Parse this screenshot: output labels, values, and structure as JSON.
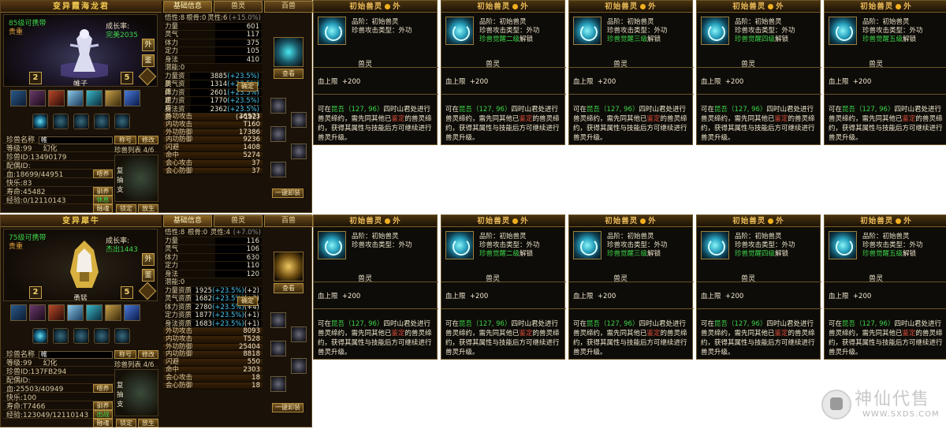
{
  "pet_panels": [
    {
      "title": "变异霞海龙君",
      "tabs": [
        "基础信息",
        "兽灵",
        "百兽"
      ],
      "carry": "85级可携带",
      "quality": "贵重",
      "growth_label": "成长率:",
      "growth_value": "完美2035",
      "grade_left": "2",
      "grade_right": "5",
      "side_buttons": [
        "外",
        "鉴"
      ],
      "pet_label": "帷子",
      "name_label": "珍兽名称",
      "name_value": "帷",
      "nick_btn": "称号",
      "modify_btn": "修改",
      "level": "等级:99",
      "phantom": "幻化",
      "pet_id": "珍兽ID:13490179",
      "spouse": "配偶ID:",
      "list_label": "珍兽列表 4/6",
      "hp": "血:18699/44951",
      "happy": "快乐:83",
      "life": "寿命:45482",
      "exp": "经验:0/12110143",
      "btn_feed": "喂养",
      "btn_tame": "驯养",
      "btn_status": "休息",
      "btn_fuse": "融魂",
      "btn_lock": "锁定",
      "btn_release": "放生",
      "list_side": "复\n抽\n支",
      "bone": "悟性:8",
      "root": "根骨:0",
      "spirit": "灵性:6",
      "spirit_extra": "(+15.0%)",
      "stats": [
        {
          "label": "力量",
          "value": "601"
        },
        {
          "label": "灵气",
          "value": "117"
        },
        {
          "label": "体力",
          "value": "375"
        },
        {
          "label": "定力",
          "value": "105"
        },
        {
          "label": "身法",
          "value": "410"
        }
      ],
      "potential": "潜能:0",
      "confirm": "确定",
      "aptitudes": [
        {
          "label": "力量资质",
          "base": "3885",
          "pct": "(+23.5%)",
          "bonus": "(+584)"
        },
        {
          "label": "灵气资质",
          "base": "1314",
          "pct": "(+23.5%)",
          "bonus": "(+138)"
        },
        {
          "label": "体力资质",
          "base": "2601",
          "pct": "(+23.5%)",
          "bonus": "(+211)"
        },
        {
          "label": "定力资质",
          "base": "1770",
          "pct": "(+23.5%)",
          "bonus": "(+98)"
        },
        {
          "label": "身法资质",
          "base": "2362",
          "pct": "(+23.5%)",
          "bonus": "(+192)"
        }
      ],
      "attrs": [
        {
          "label": "外功攻击",
          "value": "36573"
        },
        {
          "label": "内功攻击",
          "value": "T160"
        },
        {
          "label": "外功防御",
          "value": "17386"
        },
        {
          "label": "内功防御",
          "value": "9236"
        },
        {
          "label": "闪避",
          "value": "1408"
        },
        {
          "label": "命中",
          "value": "5274"
        },
        {
          "label": "会心攻击",
          "value": "37"
        },
        {
          "label": "会心防御",
          "value": "37"
        }
      ],
      "view_btn": "查看",
      "unload_btn": "一键卸装"
    },
    {
      "title": "变异犀牛",
      "tabs": [
        "基础信息",
        "兽灵",
        "百兽"
      ],
      "carry": "75级可携带",
      "quality": "贵重",
      "growth_label": "成长率:",
      "growth_value": "杰出1443",
      "grade_left": "2",
      "grade_right": "5",
      "side_buttons": [
        "外",
        "鉴"
      ],
      "pet_label": "勇猛",
      "name_label": "珍兽名称",
      "name_value": "帷",
      "nick_btn": "称号",
      "modify_btn": "修改",
      "level": "等级:99",
      "phantom": "幻化",
      "pet_id": "珍兽ID:137FB294",
      "spouse": "配偶ID:",
      "list_label": "珍兽列表 4/6",
      "hp": "血:25503/40949",
      "happy": "快乐:100",
      "life": "寿命:T7466",
      "exp": "经验:123049/12110143",
      "btn_feed": "喂养",
      "btn_tame": "驯养",
      "btn_status": "出战",
      "btn_fuse": "融魂",
      "btn_lock": "锁定",
      "btn_release": "放生",
      "list_side": "复\n抽\n支",
      "bone": "悟性:8",
      "root": "根骨:0",
      "spirit": "灵性:4",
      "spirit_extra": "(+7.0%)",
      "stats": [
        {
          "label": "力量",
          "value": "116"
        },
        {
          "label": "灵气",
          "value": "106"
        },
        {
          "label": "体力",
          "value": "630"
        },
        {
          "label": "定力",
          "value": "110"
        },
        {
          "label": "身法",
          "value": "120"
        }
      ],
      "potential": "潜能:0",
      "confirm": "确定",
      "aptitudes": [
        {
          "label": "力量资质",
          "base": "1925",
          "pct": "(+23.5%)",
          "bonus": "(+2)"
        },
        {
          "label": "灵气资质",
          "base": "1682",
          "pct": "(+23.5%)",
          "bonus": "(+3)"
        },
        {
          "label": "体力资质",
          "base": "2780",
          "pct": "(+23.5%)",
          "bonus": "(+4)"
        },
        {
          "label": "定力资质",
          "base": "1877",
          "pct": "(+23.5%)",
          "bonus": "(+1)"
        },
        {
          "label": "身法资质",
          "base": "1683",
          "pct": "(+23.5%)",
          "bonus": "(+1)"
        }
      ],
      "attrs": [
        {
          "label": "外功攻击",
          "value": "8093"
        },
        {
          "label": "内功攻击",
          "value": "T528"
        },
        {
          "label": "外功防御",
          "value": "25404"
        },
        {
          "label": "内功防御",
          "value": "8818"
        },
        {
          "label": "闪避",
          "value": "550"
        },
        {
          "label": "命中",
          "value": "2303"
        },
        {
          "label": "会心攻击",
          "value": "18"
        },
        {
          "label": "会心防御",
          "value": "18"
        }
      ],
      "view_btn": "查看",
      "unload_btn": "一键卸装"
    }
  ],
  "cards": [
    {
      "title": "初始兽灵",
      "title_suffix": "外",
      "grade": "品阶：初始兽灵",
      "atk_type": "珍兽攻击类型：外功",
      "awaken": "",
      "awaken_suffix": ""
    },
    {
      "title": "初始兽灵",
      "title_suffix": "外",
      "grade": "品阶：初始兽灵",
      "atk_type": "珍兽攻击类型：外功",
      "awaken": "珍兽觉醒二级",
      "awaken_suffix": "解锁"
    },
    {
      "title": "初始兽灵",
      "title_suffix": "外",
      "grade": "品阶：初始兽灵",
      "atk_type": "珍兽攻击类型：外功",
      "awaken": "珍兽觉醒三级",
      "awaken_suffix": "解锁"
    },
    {
      "title": "初始兽灵",
      "title_suffix": "外",
      "grade": "品阶：初始兽灵",
      "atk_type": "珍兽攻击类型：外功",
      "awaken": "珍兽觉醒四级",
      "awaken_suffix": "解锁"
    },
    {
      "title": "初始兽灵",
      "title_suffix": "外",
      "grade": "品阶：初始兽灵",
      "atk_type": "珍兽攻击类型：外功",
      "awaken": "珍兽觉醒五级",
      "awaken_suffix": "解锁"
    }
  ],
  "card_common": {
    "sub_label": "兽灵",
    "hp_label": "血上限",
    "hp_value": "+200",
    "desc_1": "可在",
    "desc_place": "昆吾（127, 96）",
    "desc_2": "四时山君处进行兽灵缔约，需先同其他已",
    "desc_appraise": "鉴定",
    "desc_3": "的兽灵缔约，获得其属性与技能后方可继续进行兽灵升级。"
  },
  "watermark": {
    "brand": "神仙代售",
    "url": "WWW.SXDS.COM"
  },
  "colors": {
    "panel_bg": "#1a1209",
    "gold": "#e8c860",
    "green": "#3cd24a",
    "cyan": "#3cc8e8",
    "border": "#6a5428"
  }
}
